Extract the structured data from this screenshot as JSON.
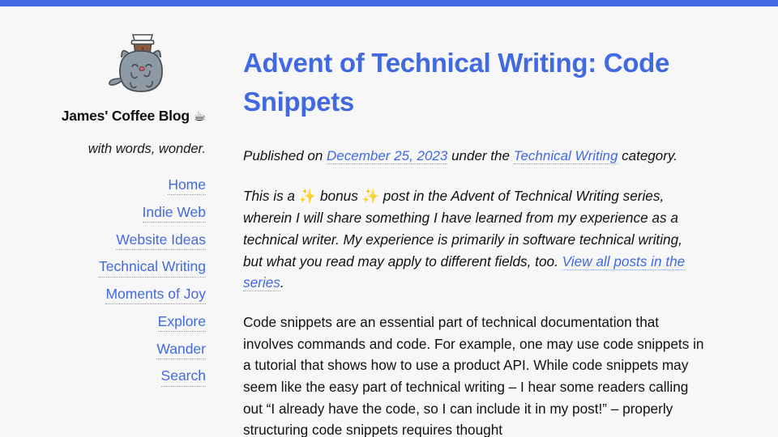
{
  "theme": {
    "accent": "#4169e1",
    "background": "#f7f7f7",
    "text": "#111111",
    "link_underline": "#7f9af0"
  },
  "top_bar": {
    "name": "top-accent-bar",
    "color": "#4169e1"
  },
  "sidebar": {
    "logo_alt": "pusheen-style grey cat holding a takeaway coffee cup",
    "site_title_text": "James' Coffee Blog ",
    "site_title_emoji": "☕",
    "tagline": "with words, wonder.",
    "nav": [
      {
        "label": "Home"
      },
      {
        "label": "Indie Web"
      },
      {
        "label": "Website Ideas"
      },
      {
        "label": "Technical Writing"
      },
      {
        "label": "Moments of Joy"
      },
      {
        "label": "Explore"
      },
      {
        "label": "Wander"
      },
      {
        "label": "Search"
      }
    ]
  },
  "post": {
    "title": "Advent of Technical Writing: Code Snippets",
    "meta": {
      "published_prefix": "Published on ",
      "date_link": "December 25, 2023",
      "under_the": " under the ",
      "category_link": "Technical Writing",
      "suffix": " category."
    },
    "intro": {
      "part1": "This is a ",
      "emoji1": "✨",
      "part2": " bonus ",
      "emoji2": "✨",
      "part3": " post in the Advent of Technical Writing series, wherein I will share something I have learned from my experience as a technical writer. My experience is primarily in software technical writing, but what you read may apply to different fields, too. ",
      "series_link": "View all posts in the series",
      "part4": "."
    },
    "paragraph_1": "Code snippets are an essential part of technical documentation that involves commands and code. For example, one may use code snippets in a tutorial that shows how to use a product API. While code snippets may seem like the easy part of technical writing – I hear some readers calling out “I already have the code, so I can include it in my post!” – properly structuring code snippets requires thought"
  }
}
